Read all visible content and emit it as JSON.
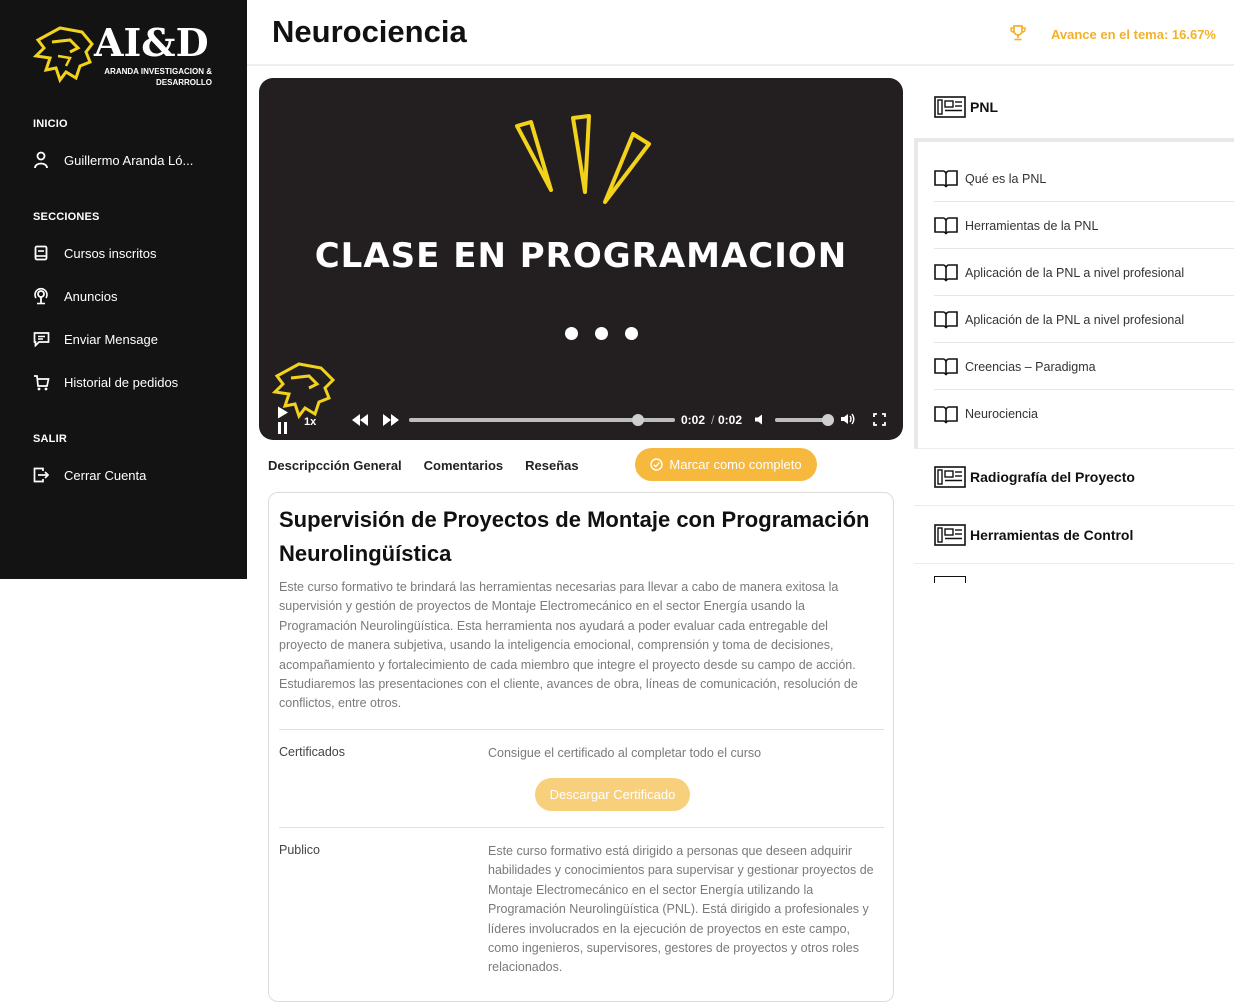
{
  "brand": {
    "name": "AI&D",
    "subtitle": "ARANDA INVESTIGACION & DESARROLLO"
  },
  "sidebar": {
    "section_home": "INICIO",
    "user_name": "Guillermo Aranda Ló...",
    "section_sections": "SECCIONES",
    "items": [
      {
        "label": "Cursos inscritos",
        "icon": "book-icon"
      },
      {
        "label": "Anuncios",
        "icon": "broadcast-icon"
      },
      {
        "label": "Enviar Mensage",
        "icon": "message-icon"
      },
      {
        "label": "Historial de pedidos",
        "icon": "cart-icon"
      }
    ],
    "section_exit": "SALIR",
    "logout_label": "Cerrar Cuenta"
  },
  "header": {
    "title": "Neurociencia",
    "progress_label": "Avance en el tema: 16.67%",
    "progress_value": 16.67
  },
  "video": {
    "overlay_title": "CLASE EN PROGRAMACION",
    "speed": "1x",
    "current_time": "0:02",
    "separator": "/",
    "duration": "0:02",
    "progress_fraction": 0.86,
    "volume_fraction": 0.95
  },
  "tabs": [
    "Descripcción General",
    "Comentarios",
    "Reseñas"
  ],
  "complete_button": "Marcar como completo",
  "course": {
    "title": "Supervisión de Proyectos de Montaje con Programación Neurolingüística",
    "description": "Este curso formativo te brindará las herramientas necesarias para llevar a cabo de manera exitosa la supervisión y gestión de proyectos de Montaje Electromecánico en el sector Energía usando la Programación Neurolingüística. Esta herramienta nos ayudará a poder evaluar cada entregable del proyecto de manera subjetiva, usando la inteligencia emocional, comprensión y toma de decisiones, acompañamiento y fortalecimiento de cada miembro que integre el proyecto desde su campo de acción. Estudiaremos las presentaciones con el cliente, avances de obra, líneas de comunicación, resolución de conflictos, entre otros.",
    "cert_label": "Certificados",
    "cert_text": "Consigue el certificado al completar todo el curso",
    "cert_button": "Descargar Certificado",
    "public_label": "Publico",
    "public_text": "Este curso formativo está dirigido a personas que deseen adquirir habilidades y conocimientos para supervisar y gestionar proyectos de Montaje Electromecánico en el sector Energía utilizando la Programación Neurolingüística (PNL). Está dirigido a profesionales y líderes involucrados en la ejecución de proyectos en este campo, como ingenieros, supervisores, gestores de proyectos y otros roles relacionados."
  },
  "modules": {
    "active": "PNL",
    "lessons": [
      "Qué es la PNL",
      "Herramientas de la PNL",
      "Aplicación de la PNL a nivel profesional",
      "Aplicación de la PNL a nivel profesional",
      "Creencias – Paradigma",
      "Neurociencia"
    ],
    "others": [
      "Radiografía del Proyecto",
      "Herramientas de Control"
    ]
  },
  "colors": {
    "accent": "#f6b83d",
    "sidebar_bg": "#131313",
    "video_bg": "#231f20"
  }
}
